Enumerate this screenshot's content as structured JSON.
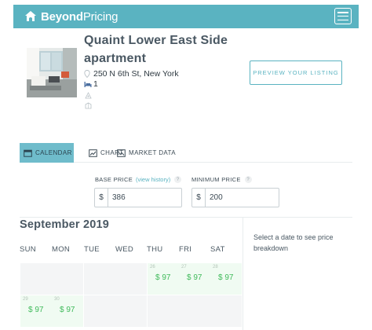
{
  "header": {
    "brand_bold": "Beyond",
    "brand_light": "Pricing",
    "logo_icon": "house-logo-icon",
    "menu_icon": "hamburger-menu-icon",
    "color": "#5ab3c1"
  },
  "listing": {
    "title_line1": "Quaint Lower East Side",
    "title_line2": "apartment",
    "address": "250 N 6th St, New York",
    "bedrooms": "1",
    "preview_button": "PREVIEW YOUR LISTING"
  },
  "tabs": [
    {
      "label": "CALENDAR",
      "icon": "calendar-icon",
      "active": true
    },
    {
      "label": "CHART",
      "icon": "chart-icon",
      "active": false
    },
    {
      "label": "MARKET DATA",
      "icon": "market-data-icon",
      "active": false
    }
  ],
  "pricing": {
    "base_label": "BASE PRICE",
    "history_link": "(view history)",
    "base_currency": "$",
    "base_value": "386",
    "min_label": "MINIMUM PRICE",
    "min_currency": "$",
    "min_value": "200",
    "help_glyph": "?"
  },
  "calendar": {
    "month": "September 2019",
    "weekdays": [
      "SUN",
      "MON",
      "TUE",
      "WED",
      "THU",
      "FRI",
      "SAT"
    ],
    "days": [
      {
        "date": "26",
        "price": "$ 97"
      },
      {
        "date": "27",
        "price": "$ 97"
      },
      {
        "date": "28",
        "price": "$ 97"
      },
      {
        "date": "29",
        "price": "$ 97"
      },
      {
        "date": "30",
        "price": "$ 97"
      }
    ],
    "hint": "Select a date to see price breakdown",
    "price_color": "#3fba5a"
  }
}
